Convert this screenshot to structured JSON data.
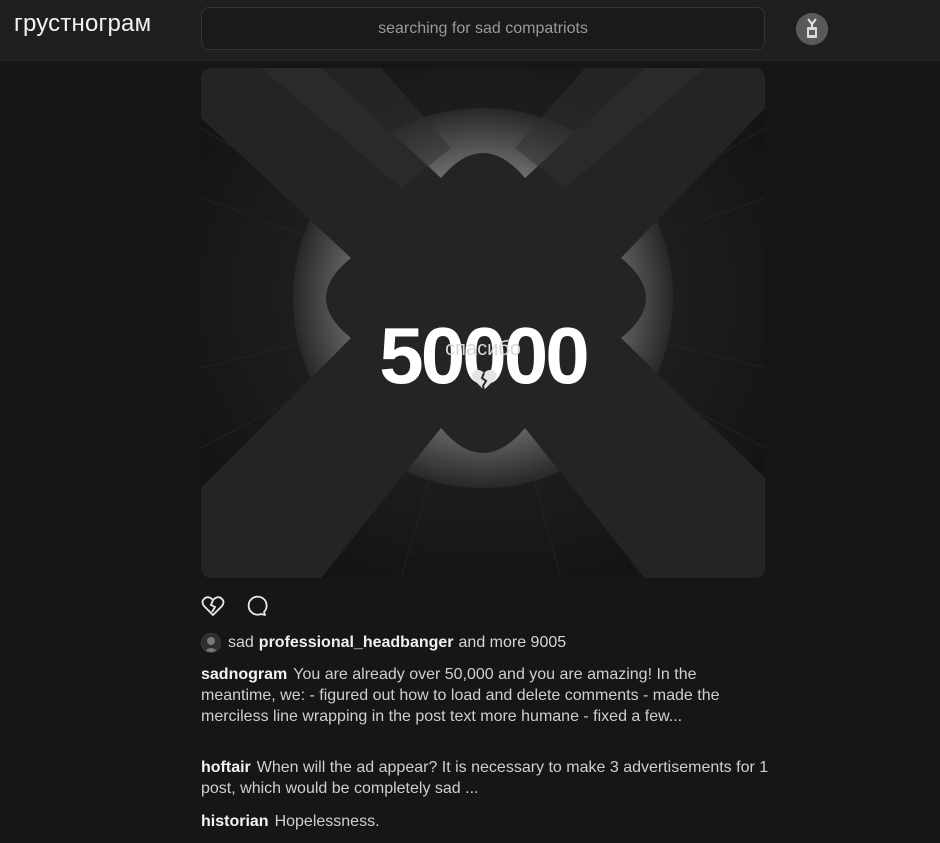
{
  "header": {
    "logo": "грустнограм",
    "search_placeholder": "searching for sad compatriots"
  },
  "post": {
    "image": {
      "number": "50000",
      "subtitle": "спасибо",
      "icon": "broken-heart-icon"
    },
    "actions": {
      "like_icon": "broken-heart-icon",
      "comment_icon": "comment-bubble-icon"
    },
    "likes": {
      "prefix": "sad",
      "user": "professional_headbanger",
      "suffix": "and more 9005"
    },
    "caption": {
      "author": "sadnogram",
      "text": "You are already over 50,000 and you are amazing! In the meantime, we: - figured out how to load and delete comments - made the merciless line wrapping in the post text more humane - fixed a few..."
    },
    "comments": [
      {
        "author": "hoftair",
        "text": "When will the ad appear? It is necessary to make 3 advertisements for 1 post, which would be completely sad ..."
      },
      {
        "author": "historian",
        "text": "Hopelessness."
      }
    ]
  },
  "colors": {
    "background": "#161616",
    "header": "#1f1f1f",
    "text": "#cfcfcf"
  }
}
